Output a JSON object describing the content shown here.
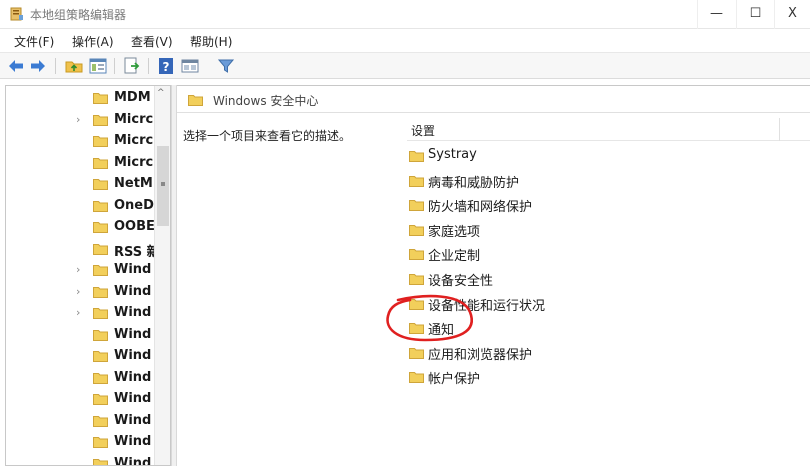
{
  "window": {
    "title": "本地组策略编辑器",
    "minimize": "—",
    "maximize": "☐",
    "close": "X"
  },
  "menu": {
    "file": "文件(F)",
    "action": "操作(A)",
    "view": "查看(V)",
    "help": "帮助(H)"
  },
  "toolbar": {
    "icons": [
      "back-arrow-icon",
      "forward-arrow-icon",
      "up-folder-icon",
      "show-hide-tree-icon",
      "export-list-icon",
      "help-icon",
      "properties-icon",
      "filter-icon"
    ]
  },
  "tree": {
    "items": [
      {
        "label": "MDM",
        "expandable": false
      },
      {
        "label": "Micrc",
        "expandable": true
      },
      {
        "label": "Micrc",
        "expandable": false
      },
      {
        "label": "Micrc",
        "expandable": false
      },
      {
        "label": "NetM",
        "expandable": false
      },
      {
        "label": "OneD",
        "expandable": false
      },
      {
        "label": "OOBE",
        "expandable": false
      },
      {
        "label": "RSS 新",
        "expandable": false
      },
      {
        "label": "Wind",
        "expandable": true
      },
      {
        "label": "Wind",
        "expandable": true
      },
      {
        "label": "Wind",
        "expandable": true
      },
      {
        "label": "Wind",
        "expandable": false
      },
      {
        "label": "Wind",
        "expandable": false
      },
      {
        "label": "Wind",
        "expandable": false
      },
      {
        "label": "Wind",
        "expandable": false
      },
      {
        "label": "Wind",
        "expandable": false
      },
      {
        "label": "Wind",
        "expandable": false
      },
      {
        "label": "Wind",
        "expandable": false
      }
    ]
  },
  "main": {
    "breadcrumb": "Windows 安全中心",
    "description": "选择一个项目来查看它的描述。",
    "column_header": "设置",
    "items": [
      "Systray",
      "病毒和威胁防护",
      "防火墙和网络保护",
      "家庭选项",
      "企业定制",
      "设备安全性",
      "设备性能和运行状况",
      "通知",
      "应用和浏览器保护",
      "帐户保护"
    ],
    "highlighted_item": "通知"
  },
  "colors": {
    "folder": "#f2cf5b",
    "annotation": "#e02020"
  }
}
